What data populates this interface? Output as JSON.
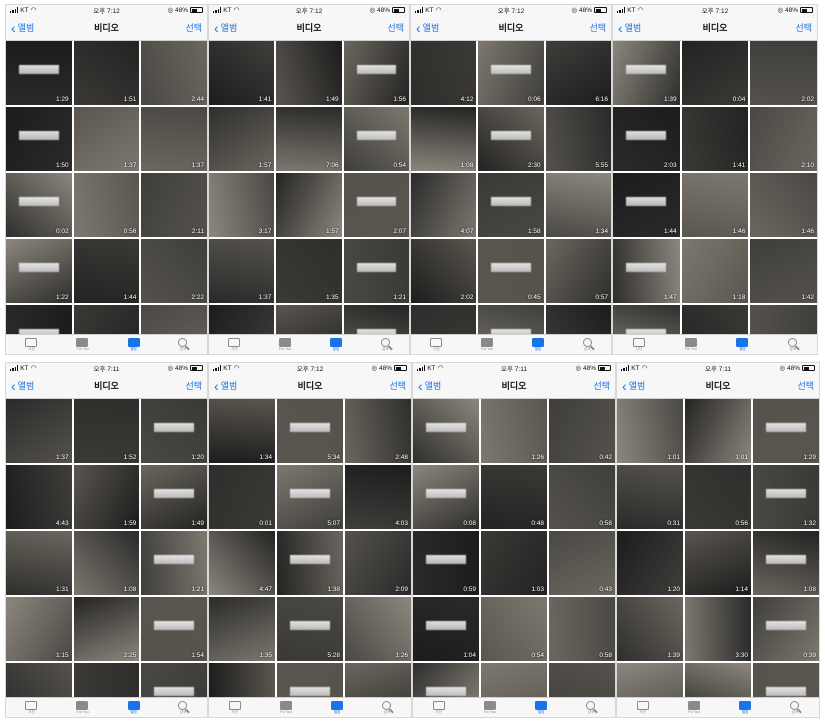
{
  "phones": [
    {
      "time": "오후 7:12",
      "carrier": "KT",
      "battery": "48%",
      "back": "앨범",
      "title": "비디오",
      "select": "선택",
      "tiles": [
        "1:29",
        "1:51",
        "2:44",
        "1:50",
        "1:37",
        "1:37",
        "0:02",
        "0:56",
        "2:11",
        "1:22",
        "1:44",
        "2:22",
        "",
        "",
        ""
      ],
      "tabs": [
        "사진",
        "For You",
        "앨범",
        "검색"
      ]
    },
    {
      "time": "오후 7:12",
      "carrier": "KT",
      "battery": "48%",
      "back": "앨범",
      "title": "비디오",
      "select": "선택",
      "tiles": [
        "1:41",
        "1:49",
        "1:56",
        "1:57",
        "7:06",
        "0:54",
        "3:17",
        "1:57",
        "2:07",
        "1:37",
        "1:35",
        "1:21",
        "",
        "",
        ""
      ],
      "tabs": [
        "사진",
        "For You",
        "앨범",
        "검색"
      ]
    },
    {
      "time": "오후 7:12",
      "carrier": "KT",
      "battery": "48%",
      "back": "앨범",
      "title": "비디오",
      "select": "선택",
      "tiles": [
        "4:12",
        "0:06",
        "6:16",
        "1:08",
        "2:30",
        "5:55",
        "4:07",
        "1:58",
        "1:34",
        "2:02",
        "0:45",
        "0:57",
        "",
        "",
        ""
      ],
      "tabs": [
        "사진",
        "For You",
        "앨범",
        "검색"
      ]
    },
    {
      "time": "오후 7:12",
      "carrier": "KT",
      "battery": "48%",
      "back": "앨범",
      "title": "비디오",
      "select": "선택",
      "tiles": [
        "1:39",
        "0:04",
        "2:02",
        "2:03",
        "1:41",
        "2:10",
        "1:44",
        "1:46",
        "1:46",
        "1:47",
        "1:18",
        "1:42",
        "",
        "",
        ""
      ],
      "tabs": [
        "사진",
        "For You",
        "앨범",
        "검색"
      ]
    },
    {
      "time": "오후 7:11",
      "carrier": "KT",
      "battery": "48%",
      "back": "앨범",
      "title": "비디오",
      "select": "선택",
      "tiles": [
        "1:37",
        "1:52",
        "1:20",
        "4:43",
        "1:59",
        "1:49",
        "1:31",
        "1:08",
        "1:21",
        "1:15",
        "2:25",
        "1:54",
        "",
        "",
        ""
      ],
      "tabs": [
        "사진",
        "For You",
        "앨범",
        "검색"
      ]
    },
    {
      "time": "오후 7:12",
      "carrier": "KT",
      "battery": "48%",
      "back": "앨범",
      "title": "비디오",
      "select": "선택",
      "tiles": [
        "1:34",
        "5:34",
        "2:48",
        "0:01",
        "5:07",
        "4:03",
        "4:47",
        "1:38",
        "2:09",
        "1:35",
        "5:28",
        "1:26",
        "",
        "",
        ""
      ],
      "tabs": [
        "사진",
        "For You",
        "앨범",
        "검색"
      ]
    },
    {
      "time": "오후 7:11",
      "carrier": "KT",
      "battery": "48%",
      "back": "앨범",
      "title": "비디오",
      "select": "선택",
      "tiles": [
        "",
        "1:26",
        "0:42",
        "0:08",
        "0:48",
        "0:58",
        "0:59",
        "1:03",
        "0:43",
        "1:04",
        "0:54",
        "0:58",
        "",
        "",
        ""
      ],
      "tabs": [
        "사진",
        "For You",
        "앨범",
        "검색"
      ]
    },
    {
      "time": "오후 7:11",
      "carrier": "KT",
      "battery": "48%",
      "back": "앨범",
      "title": "비디오",
      "select": "선택",
      "tiles": [
        "1:01",
        "1:01",
        "1:29",
        "0:31",
        "0:56",
        "1:32",
        "1:20",
        "1:14",
        "1:08",
        "1:39",
        "3:30",
        "0:39",
        "",
        "",
        ""
      ],
      "tabs": [
        "사진",
        "For You",
        "앨범",
        "검색"
      ]
    }
  ],
  "colors": {
    "accent": "#1a73e8",
    "bar": "#f7f7f7"
  }
}
